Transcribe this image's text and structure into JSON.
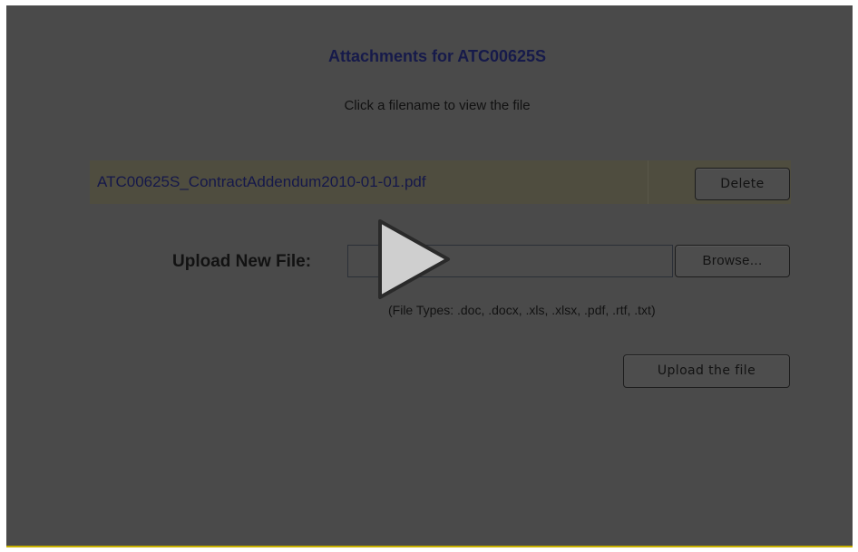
{
  "page": {
    "title": "Attachments for ATC00625S",
    "subtitle": "Click a filename to view the file"
  },
  "attachments": [
    {
      "filename": "ATC00625S_ContractAddendum2010-01-01.pdf",
      "delete_label": "Delete"
    }
  ],
  "upload": {
    "label": "Upload New File:",
    "file_value": "",
    "browse_label": "Browse...",
    "file_types": "(File Types: .doc, .docx, .xls, .xlsx, .pdf, .rtf, .txt)",
    "submit_label": "Upload the file"
  },
  "overlay": {
    "icon": "play-icon"
  },
  "colors": {
    "overlay_background": "#4a4a4a",
    "title": "#161a4a",
    "file_row_background": "#4f4d3f",
    "accent_border": "#c9b200"
  }
}
